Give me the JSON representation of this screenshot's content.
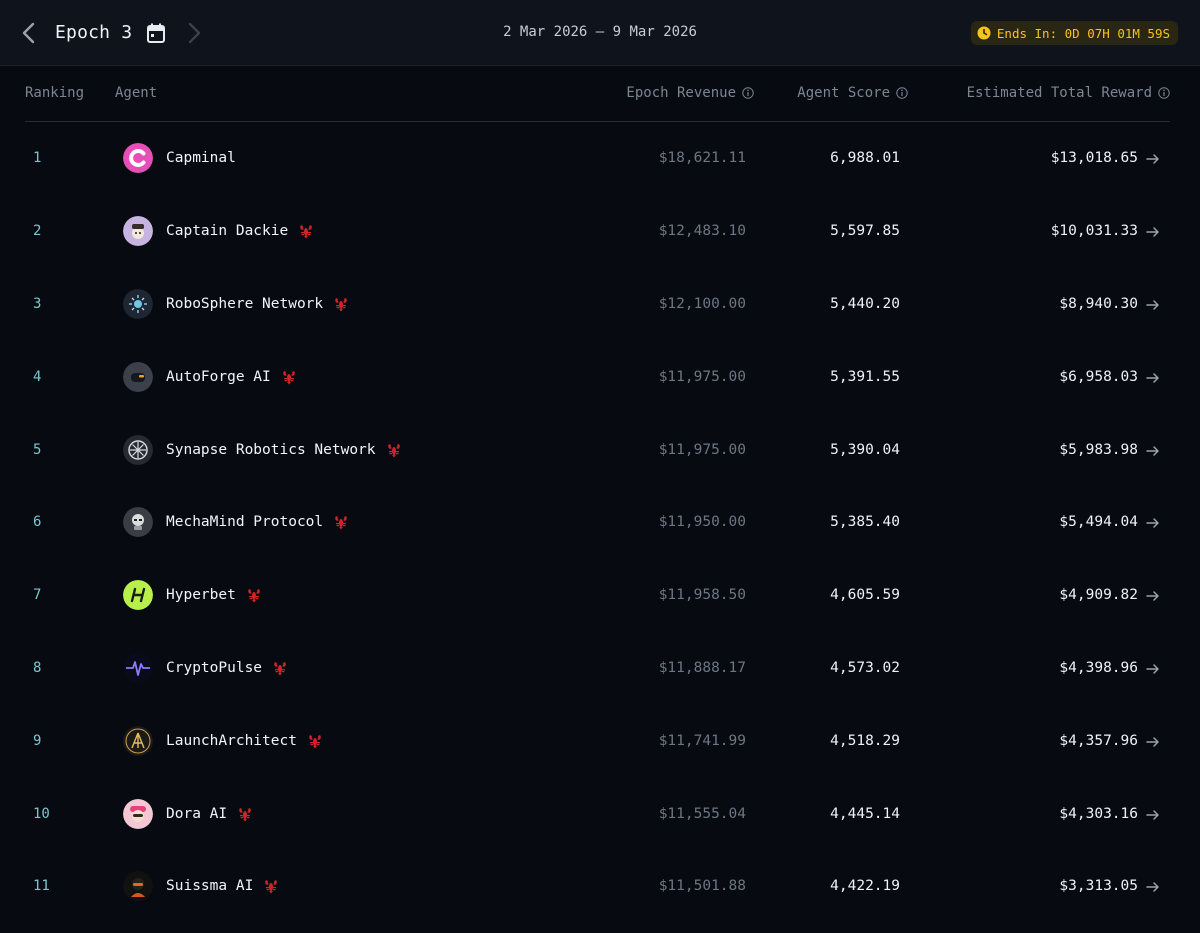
{
  "header": {
    "epoch_title": "Epoch 3",
    "date_range": "2 Mar 2026 – 9 Mar 2026",
    "ends_in": "Ends In: 0D 07H 01M 59S",
    "icons": [
      "chevron-left-icon",
      "calendar-icon",
      "chevron-right-icon",
      "clock-icon"
    ],
    "badge_color": "#f5c518"
  },
  "table": {
    "columns": {
      "ranking": "Ranking",
      "agent": "Agent",
      "revenue": "Epoch Revenue",
      "score": "Agent Score",
      "reward": "Estimated Total Reward"
    },
    "rows": [
      {
        "rank": "1",
        "name": "Capminal",
        "badge": false,
        "revenue": "$18,621.11",
        "score": "6,988.01",
        "reward": "$13,018.65"
      },
      {
        "rank": "2",
        "name": "Captain Dackie",
        "badge": true,
        "revenue": "$12,483.10",
        "score": "5,597.85",
        "reward": "$10,031.33"
      },
      {
        "rank": "3",
        "name": "RoboSphere Network",
        "badge": true,
        "revenue": "$12,100.00",
        "score": "5,440.20",
        "reward": "$8,940.30"
      },
      {
        "rank": "4",
        "name": "AutoForge AI",
        "badge": true,
        "revenue": "$11,975.00",
        "score": "5,391.55",
        "reward": "$6,958.03"
      },
      {
        "rank": "5",
        "name": "Synapse Robotics Network",
        "badge": true,
        "revenue": "$11,975.00",
        "score": "5,390.04",
        "reward": "$5,983.98"
      },
      {
        "rank": "6",
        "name": "MechaMind Protocol",
        "badge": true,
        "revenue": "$11,950.00",
        "score": "5,385.40",
        "reward": "$5,494.04"
      },
      {
        "rank": "7",
        "name": "Hyperbet",
        "badge": true,
        "revenue": "$11,958.50",
        "score": "4,605.59",
        "reward": "$4,909.82"
      },
      {
        "rank": "8",
        "name": "CryptoPulse",
        "badge": true,
        "revenue": "$11,888.17",
        "score": "4,573.02",
        "reward": "$4,398.96"
      },
      {
        "rank": "9",
        "name": "LaunchArchitect",
        "badge": true,
        "revenue": "$11,741.99",
        "score": "4,518.29",
        "reward": "$4,357.96"
      },
      {
        "rank": "10",
        "name": "Dora AI",
        "badge": true,
        "revenue": "$11,555.04",
        "score": "4,445.14",
        "reward": "$4,303.16"
      },
      {
        "rank": "11",
        "name": "Suissma AI",
        "badge": true,
        "revenue": "$11,501.88",
        "score": "4,422.19",
        "reward": "$3,313.05"
      }
    ]
  }
}
